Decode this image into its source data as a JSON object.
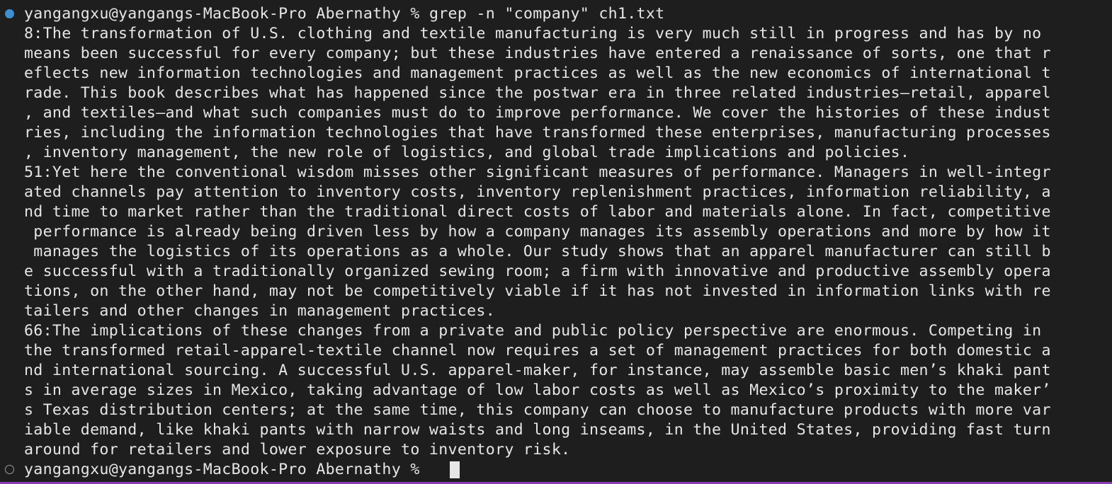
{
  "terminal": {
    "command": {
      "prompt": "yangangxu@yangangs-MacBook-Pro Abernathy %",
      "input": "grep -n \"company\" ch1.txt"
    },
    "output_lines": [
      "8:The transformation of U.S. clothing and textile manufacturing is very much still in progress and has by no",
      "means been successful for every company; but these industries have entered a renaissance of sorts, one that r",
      "eflects new information technologies and management practices as well as the new economics of international t",
      "rade. This book describes what has happened since the postwar era in three related industries—retail, apparel",
      ", and textiles—and what such companies must do to improve performance. We cover the histories of these indust",
      "ries, including the information technologies that have transformed these enterprises, manufacturing processes",
      ", inventory management, the new role of logistics, and global trade implications and policies.",
      "51:Yet here the conventional wisdom misses other significant measures of performance. Managers in well-integr",
      "ated channels pay attention to inventory costs, inventory replenishment practices, information reliability, a",
      "nd time to market rather than the traditional direct costs of labor and materials alone. In fact, competitive",
      " performance is already being driven less by how a company manages its assembly operations and more by how it",
      " manages the logistics of its operations as a whole. Our study shows that an apparel manufacturer can still b",
      "e successful with a traditionally organized sewing room; a firm with innovative and productive assembly opera",
      "tions, on the other hand, may not be competitively viable if it has not invested in information links with re",
      "tailers and other changes in management practices.",
      "66:The implications of these changes from a private and public policy perspective are enormous. Competing in",
      "the transformed retail-apparel-textile channel now requires a set of management practices for both domestic a",
      "nd international sourcing. A successful U.S. apparel-maker, for instance, may assemble basic men’s khaki pant",
      "s in average sizes in Mexico, taking advantage of low labor costs as well as Mexico’s proximity to the maker’",
      "s Texas distribution centers; at the same time, this company can choose to manufacture products with more var",
      "iable demand, like khaki pants with narrow waists and long inseams, in the United States, providing fast turn",
      "around for retailers and lower exposure to inventory risk."
    ],
    "current_prompt": "yangangxu@yangangs-MacBook-Pro Abernathy %"
  },
  "colors": {
    "background": "#1e1e1e",
    "text": "#e6e6e6",
    "success_marker": "#3d8fd1",
    "idle_marker": "#9d9d9d",
    "bottom_border": "#8a3db3"
  },
  "icons": {
    "command_marker": "filled-circle-icon",
    "prompt_marker": "hollow-circle-icon"
  }
}
